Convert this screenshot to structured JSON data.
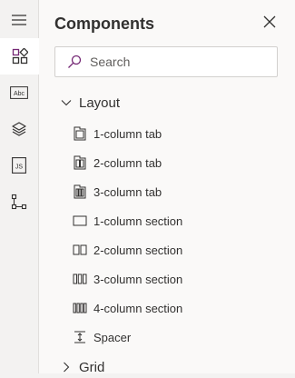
{
  "panel": {
    "title": "Components",
    "search_placeholder": "Search"
  },
  "rail": {
    "items": [
      {
        "icon": "hamburger-menu-icon"
      },
      {
        "icon": "components-icon",
        "active": true
      },
      {
        "icon": "text-field-icon",
        "glyph_text": "Abc"
      },
      {
        "icon": "layers-icon"
      },
      {
        "icon": "js-icon",
        "glyph_text": "JS"
      },
      {
        "icon": "tree-view-icon"
      }
    ]
  },
  "groups": [
    {
      "label": "Layout",
      "expanded": true,
      "items": [
        {
          "label": "1-column tab",
          "icon": "one-column-tab-icon"
        },
        {
          "label": "2-column tab",
          "icon": "two-column-tab-icon"
        },
        {
          "label": "3-column tab",
          "icon": "three-column-tab-icon"
        },
        {
          "label": "1-column section",
          "icon": "one-column-section-icon"
        },
        {
          "label": "2-column section",
          "icon": "two-column-section-icon"
        },
        {
          "label": "3-column section",
          "icon": "three-column-section-icon"
        },
        {
          "label": "4-column section",
          "icon": "four-column-section-icon"
        },
        {
          "label": "Spacer",
          "icon": "spacer-icon"
        }
      ]
    },
    {
      "label": "Grid",
      "expanded": false,
      "items": []
    }
  ],
  "colors": {
    "accent": "#742774",
    "panel_bg": "#faf9f8",
    "rail_bg": "#f3f2f1",
    "text": "#323130"
  }
}
